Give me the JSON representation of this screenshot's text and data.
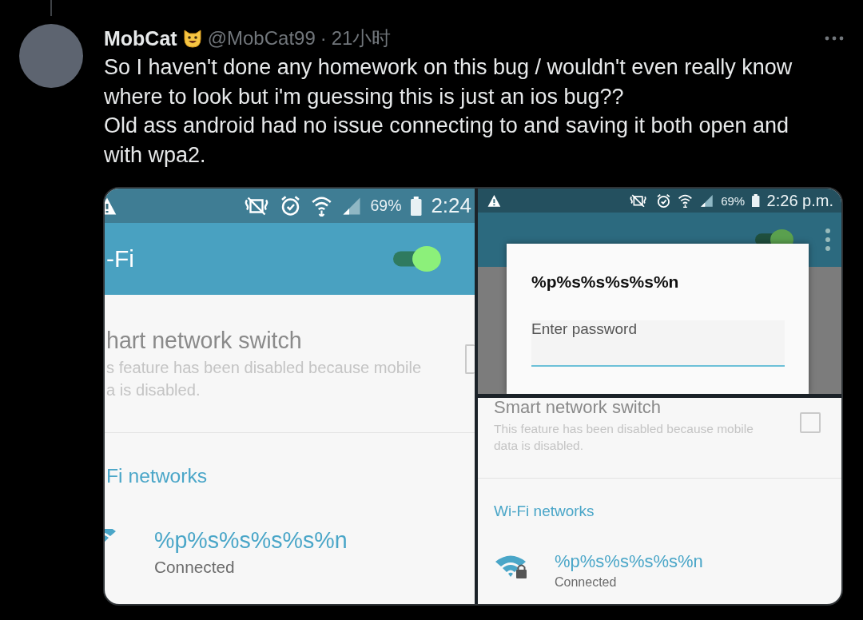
{
  "tweet": {
    "author": {
      "name": "MobCat",
      "handle": "@MobCat99"
    },
    "separator": "·",
    "time": "21小时",
    "paragraphs": [
      "So I haven't done any homework on this bug / wouldn't even really know where to look but i'm guessing this is just an ios bug??",
      "Old ass android had no issue connecting to and saving it both open and with wpa2."
    ]
  },
  "media": {
    "panels": [
      {
        "kind": "settings",
        "status_bar": {
          "battery": "69%",
          "time": "2:24"
        },
        "app_bar": {
          "title": "-Fi",
          "wifi_on": true
        },
        "smart_switch": {
          "title": "hart network switch",
          "description": [
            "s feature has been disabled because mobile",
            "a is disabled."
          ],
          "checked": false
        },
        "networks_header": "Fi networks",
        "network": {
          "ssid": "%p%s%s%s%s%n",
          "status": "Connected"
        }
      },
      {
        "kind": "password_dialog",
        "status_bar": {
          "battery": "69%",
          "time": "2:26 p.m."
        },
        "app_bar": {
          "wifi_on": true
        },
        "dialog": {
          "title": "%p%s%s%s%s%n",
          "placeholder": "Enter password"
        }
      },
      {
        "kind": "list",
        "smart_switch": {
          "title": "Smart network switch",
          "description": [
            "This feature has been disabled because mobile",
            "data is disabled."
          ],
          "checked": false
        },
        "networks_header": "Wi-Fi networks",
        "network": {
          "ssid": "%p%s%s%s%s%n",
          "status": "Connected"
        }
      }
    ]
  }
}
